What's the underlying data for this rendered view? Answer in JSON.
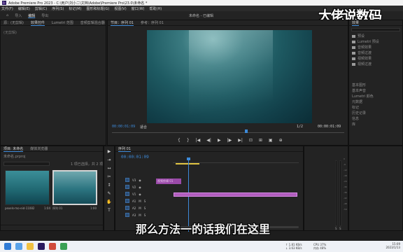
{
  "app": {
    "title": "Adobe Premiere Pro 2023 - C:\\用户\\刘小二\\文档\\Adobe\\Premiere Pro\\23.0\\未命名 *"
  },
  "menu": [
    "文件(F)",
    "编辑(E)",
    "剪辑(C)",
    "序列(S)",
    "标记(M)",
    "图形和标题(G)",
    "视图(V)",
    "窗口(W)",
    "帮助(H)"
  ],
  "workspace": {
    "home_label": "⌂",
    "tabs": [
      "导入",
      "编辑",
      "导出"
    ],
    "active_tab": "编辑",
    "center_title": "未命名 - 已编辑"
  },
  "watermark": "大佬说数码",
  "source_panel": {
    "tabs": [
      "源：(无剪辑)",
      "效果控件",
      "Lumetri 范围",
      "音频剪辑混合器"
    ],
    "clip_selector": "(无剪辑)"
  },
  "program_panel": {
    "tabs": [
      "节目：序列 01",
      "参考：序列 01"
    ],
    "timecode_left": "00:00:01:09",
    "fit_label": "适合",
    "quality_label": "1/2",
    "timecode_right": "00:00:01:09",
    "controls": [
      "{",
      "}",
      "|◀",
      "◀|",
      "▶",
      "|▶",
      "▶|",
      "⊡",
      "⊞",
      "▣",
      "⊕"
    ]
  },
  "effects_panel": {
    "title": "效果",
    "items": [
      {
        "label": "预设",
        "folder": true
      },
      {
        "label": "Lumetri 预设",
        "folder": true
      },
      {
        "label": "音频效果",
        "folder": true
      },
      {
        "label": "音频过渡",
        "folder": true
      },
      {
        "label": "视频效果",
        "folder": true
      },
      {
        "label": "视频过渡",
        "folder": true
      }
    ],
    "lower_items": [
      "基本图形",
      "基本声音",
      "Lumetri 颜色",
      "元数据",
      "标记",
      "历史记录",
      "信息",
      "库"
    ]
  },
  "project_panel": {
    "tabs": [
      "项目: 未命名",
      "媒体浏览器"
    ],
    "path": "未命名.prproj",
    "item_count": "1 项已选择，共 2 项",
    "thumbnails": [
      {
        "label": "pexels-mo-eid-11082",
        "duration": "1:04"
      },
      {
        "label": "序列 01",
        "duration": "1:00"
      }
    ]
  },
  "tools": [
    "▶",
    "⇥",
    "↔",
    "✂",
    "↕",
    "✎",
    "✋",
    "T"
  ],
  "timeline": {
    "tab": "序列 01",
    "timecode": "00:00:01:09",
    "clip_label": "视频剪辑 01",
    "tracks": [
      {
        "name": "V3"
      },
      {
        "name": "V2"
      },
      {
        "name": "V1"
      },
      {
        "name": "A1"
      },
      {
        "name": "A2"
      },
      {
        "name": "A3"
      }
    ]
  },
  "meters": {
    "scale": [
      "0",
      "-6",
      "-12",
      "-18",
      "-24",
      "-30",
      "-36",
      "-42",
      "-48",
      "-54"
    ],
    "labels": [
      "S",
      "S"
    ]
  },
  "subtitle": "那么方法一的话我们在这里",
  "taskbar": {
    "net_up": "↑ 1.81 KB/s",
    "net_down": "↓ 3.63 KB/s",
    "cpu": "CPU 37%",
    "mem": "内存 48%",
    "time": "15:09",
    "date": "2023/1/13"
  }
}
